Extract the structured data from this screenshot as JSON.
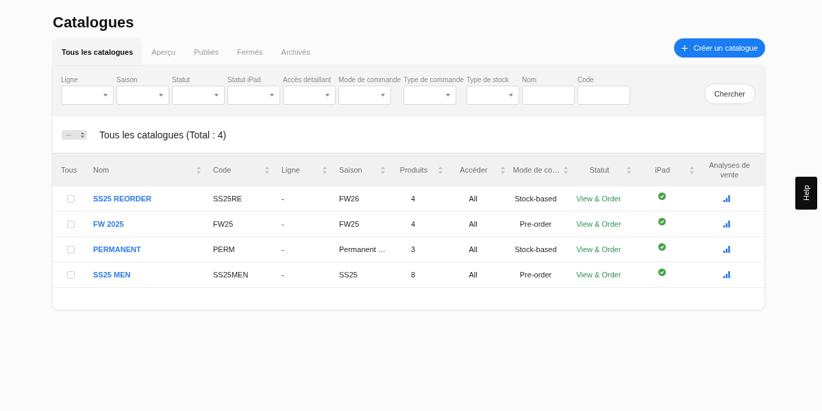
{
  "page": {
    "title": "Catalogues"
  },
  "tabs": [
    {
      "label": "Tous les catalogues",
      "selected": true
    },
    {
      "label": "Aperçu",
      "selected": false
    },
    {
      "label": "Publiés",
      "selected": false
    },
    {
      "label": "Fermés",
      "selected": false
    },
    {
      "label": "Archivés",
      "selected": false
    }
  ],
  "create_button": {
    "label": "Créer un catalogue"
  },
  "filters": [
    {
      "label": "Ligne",
      "kind": "select"
    },
    {
      "label": "Saison",
      "kind": "select"
    },
    {
      "label": "Statut",
      "kind": "select"
    },
    {
      "label": "Statut iPad",
      "kind": "select"
    },
    {
      "label": "Accès détaillant",
      "kind": "select"
    },
    {
      "label": "Mode de commande",
      "kind": "select"
    },
    {
      "label": "Type de commande",
      "kind": "select"
    },
    {
      "label": "Type de stock",
      "kind": "select"
    },
    {
      "label": "Nom",
      "kind": "text"
    },
    {
      "label": "Code",
      "kind": "text"
    }
  ],
  "search_button": {
    "label": "Chercher"
  },
  "list": {
    "page_size": "---",
    "heading": "Tous les catalogues (Total : 4)"
  },
  "table": {
    "columns": [
      {
        "label": "Tous",
        "sortable": false
      },
      {
        "label": "Nom",
        "sortable": true
      },
      {
        "label": "Code",
        "sortable": true
      },
      {
        "label": "Ligne",
        "sortable": true
      },
      {
        "label": "Saison",
        "sortable": true
      },
      {
        "label": "Produits",
        "sortable": true
      },
      {
        "label": "Accéder",
        "sortable": true
      },
      {
        "label": "Mode de co…",
        "sortable": true
      },
      {
        "label": "Statut",
        "sortable": true
      },
      {
        "label": "iPad",
        "sortable": true
      },
      {
        "label": "Analyses de vente",
        "sortable": false
      }
    ],
    "rows": [
      {
        "cells": [
          {
            "kind": "checkbox",
            "checked": false
          },
          {
            "kind": "link",
            "text": "SS25 REORDER"
          },
          {
            "kind": "text",
            "text": "SS25RE"
          },
          {
            "kind": "text",
            "text": "-"
          },
          {
            "kind": "text",
            "text": "FW26"
          },
          {
            "kind": "text",
            "text": "4"
          },
          {
            "kind": "text",
            "text": "All"
          },
          {
            "kind": "text",
            "text": "Stock-based"
          },
          {
            "kind": "status",
            "text": "View & Order"
          },
          {
            "kind": "ipad",
            "enabled": true
          },
          {
            "kind": "chart"
          }
        ]
      },
      {
        "cells": [
          {
            "kind": "checkbox",
            "checked": false
          },
          {
            "kind": "link",
            "text": "FW 2025"
          },
          {
            "kind": "text",
            "text": "FW25"
          },
          {
            "kind": "text",
            "text": "-"
          },
          {
            "kind": "text",
            "text": "FW25"
          },
          {
            "kind": "text",
            "text": "4"
          },
          {
            "kind": "text",
            "text": "All"
          },
          {
            "kind": "text",
            "text": "Pre-order"
          },
          {
            "kind": "status",
            "text": "View & Order"
          },
          {
            "kind": "ipad",
            "enabled": true
          },
          {
            "kind": "chart"
          }
        ]
      },
      {
        "cells": [
          {
            "kind": "checkbox",
            "checked": false
          },
          {
            "kind": "link",
            "text": "PERMANENT"
          },
          {
            "kind": "text",
            "text": "PERM"
          },
          {
            "kind": "text",
            "text": "-"
          },
          {
            "kind": "text",
            "text": "Permanent …"
          },
          {
            "kind": "text",
            "text": "3"
          },
          {
            "kind": "text",
            "text": "All"
          },
          {
            "kind": "text",
            "text": "Stock-based"
          },
          {
            "kind": "status",
            "text": "View & Order"
          },
          {
            "kind": "ipad",
            "enabled": true
          },
          {
            "kind": "chart"
          }
        ]
      },
      {
        "cells": [
          {
            "kind": "checkbox",
            "checked": false
          },
          {
            "kind": "link",
            "text": "SS25 MEN"
          },
          {
            "kind": "text",
            "text": "SS25MEN"
          },
          {
            "kind": "text",
            "text": "-"
          },
          {
            "kind": "text",
            "text": "SS25"
          },
          {
            "kind": "text",
            "text": "8"
          },
          {
            "kind": "text",
            "text": "All"
          },
          {
            "kind": "text",
            "text": "Pre-order"
          },
          {
            "kind": "status",
            "text": "View & Order"
          },
          {
            "kind": "ipad",
            "enabled": true
          },
          {
            "kind": "chart"
          }
        ]
      }
    ]
  },
  "help_tab": {
    "label": "Help"
  }
}
